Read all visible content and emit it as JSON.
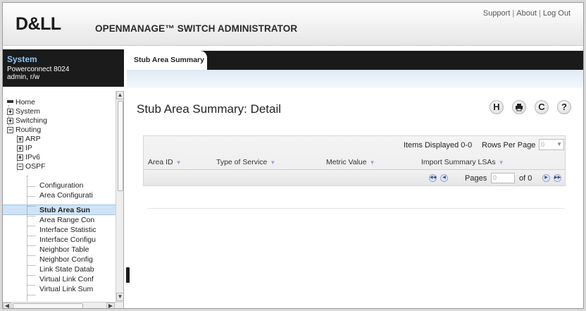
{
  "header": {
    "logo": "D&LL",
    "app_title": "OPENMANAGE™ SWITCH ADMINISTRATOR",
    "links": [
      "Support",
      "About",
      "Log Out"
    ]
  },
  "system": {
    "title": "System",
    "model": "Powerconnect 8024",
    "user": "admin, r/w"
  },
  "tree": {
    "items": [
      {
        "label": "Home",
        "icon": "home-icon"
      },
      {
        "label": "System",
        "icon": "expand-icon"
      },
      {
        "label": "Switching",
        "icon": "expand-icon"
      },
      {
        "label": "Routing",
        "icon": "collapse-icon"
      },
      {
        "label": "ARP",
        "icon": "expand-icon"
      },
      {
        "label": "IP",
        "icon": "expand-icon"
      },
      {
        "label": "IPv6",
        "icon": "expand-icon"
      },
      {
        "label": "OSPF",
        "icon": "collapse-icon"
      },
      {
        "label": "Configuration"
      },
      {
        "label": "Area Configurati"
      },
      {
        "label": "Stub Area Sun",
        "selected": true
      },
      {
        "label": "Area Range Con"
      },
      {
        "label": "Interface Statistic"
      },
      {
        "label": "Interface Configu"
      },
      {
        "label": "Neighbor Table"
      },
      {
        "label": "Neighbor Config"
      },
      {
        "label": "Link State Datab"
      },
      {
        "label": "Virtual Link Conf"
      },
      {
        "label": "Virtual Link Sum"
      }
    ]
  },
  "tabs": [
    {
      "label": "Stub Area Summary",
      "active": true
    }
  ],
  "page": {
    "title": "Stub Area Summary: Detail"
  },
  "toolbar": {
    "save_icon": "H",
    "print_icon": "printer-icon",
    "refresh_icon": "C",
    "help_icon": "?"
  },
  "grid": {
    "items_displayed": "Items Displayed 0-0",
    "rows_per_page_label": "Rows Per Page",
    "rows_per_page_value": "0",
    "columns": [
      "Area ID",
      "Type of Service",
      "Metric Value",
      "Import Summary LSAs"
    ],
    "pages_label": "Pages",
    "pages_value": "0",
    "of_label": "of 0"
  },
  "colors": {
    "accent": "#8fc6f2",
    "bar": "#1a1a1a",
    "selection": "#cfe3f7"
  }
}
